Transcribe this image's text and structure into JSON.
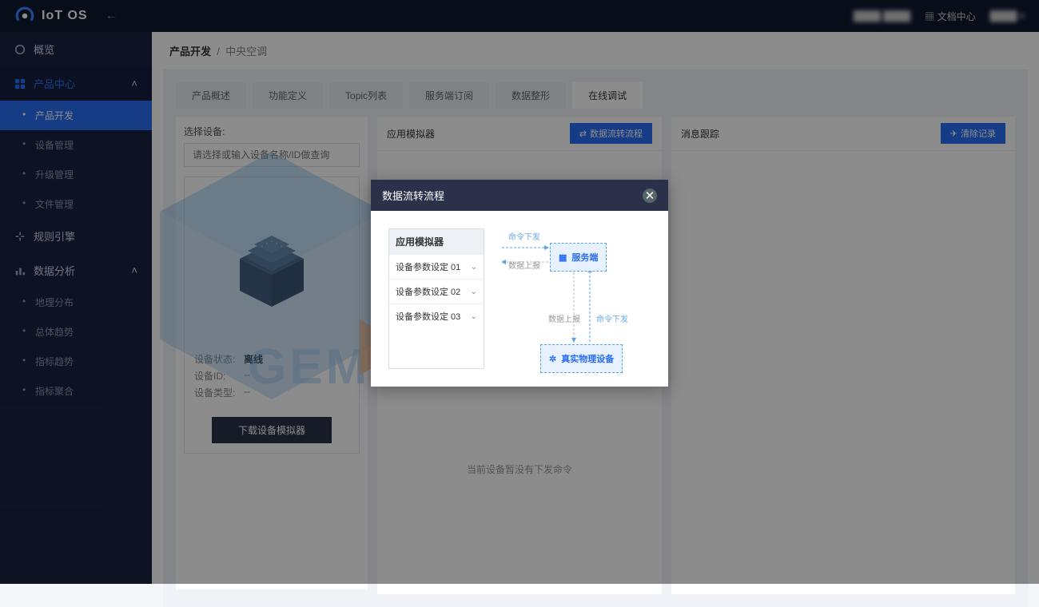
{
  "brand": "IoT OS",
  "top": {
    "docs": "文档中心"
  },
  "nav": {
    "overview": "概览",
    "product_center": "产品中心",
    "sub": {
      "product_dev": "产品开发",
      "device_mgr": "设备管理",
      "upgrade_mgr": "升级管理",
      "file_mgr": "文件管理"
    },
    "rule_engine": "规则引擎",
    "data_analysis": "数据分析",
    "da": {
      "geo": "地理分布",
      "overall_trend": "总体趋势",
      "metric_trend": "指标趋势",
      "metric_agg": "指标聚合"
    }
  },
  "crumbs": {
    "a": "产品开发",
    "b": "中央空调"
  },
  "tabs": {
    "t1": "产品概述",
    "t2": "功能定义",
    "t3": "Topic列表",
    "t4": "服务端订阅",
    "t5": "数据整形",
    "t6": "在线调试"
  },
  "colA": {
    "label": "选择设备:",
    "placeholder": "请选择或输入设备名称/ID做查询",
    "status_l": "设备状态:",
    "status_v": "离线",
    "id_l": "设备ID:",
    "id_v": "--",
    "type_l": "设备类型:",
    "type_v": "--",
    "download_btn": "下载设备模拟器"
  },
  "colB": {
    "title": "应用模拟器",
    "btn": "数据流转流程",
    "empty": "当前设备暂没有下发命令"
  },
  "colC": {
    "title": "消息跟踪",
    "btn": "清除记录"
  },
  "modal": {
    "title": "数据流转流程",
    "sim_title": "应用模拟器",
    "row1": "设备参数设定  01",
    "row2": "设备参数设定  02",
    "row3": "设备参数设定  03",
    "server": "服务端",
    "device": "真实物理设备",
    "l_cmd_down": "命令下发",
    "l_data_up": "数据上报",
    "l_data_up2": "数据上报",
    "l_cmd_down2": "命令下发"
  }
}
